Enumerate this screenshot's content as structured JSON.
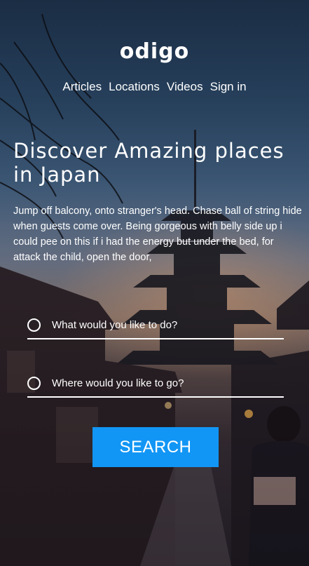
{
  "brand": {
    "logo_text": "odigo"
  },
  "nav": {
    "items": [
      {
        "label": "Articles"
      },
      {
        "label": "Locations"
      },
      {
        "label": "Videos"
      },
      {
        "label": "Sign in"
      }
    ]
  },
  "hero": {
    "title": "Discover Amazing places in Japan",
    "description": "Jump off balcony, onto stranger's head. Chase ball of string hide when guests come over. Being gorgeous with belly side up i could pee on this if i had the energy but under the bed, for attack the child, open the door,"
  },
  "search": {
    "activity_placeholder": "What would you like to do?",
    "location_placeholder": "Where would you like to go?",
    "button_label": "SEARCH"
  },
  "colors": {
    "accent": "#1296f5",
    "text": "#ffffff"
  }
}
